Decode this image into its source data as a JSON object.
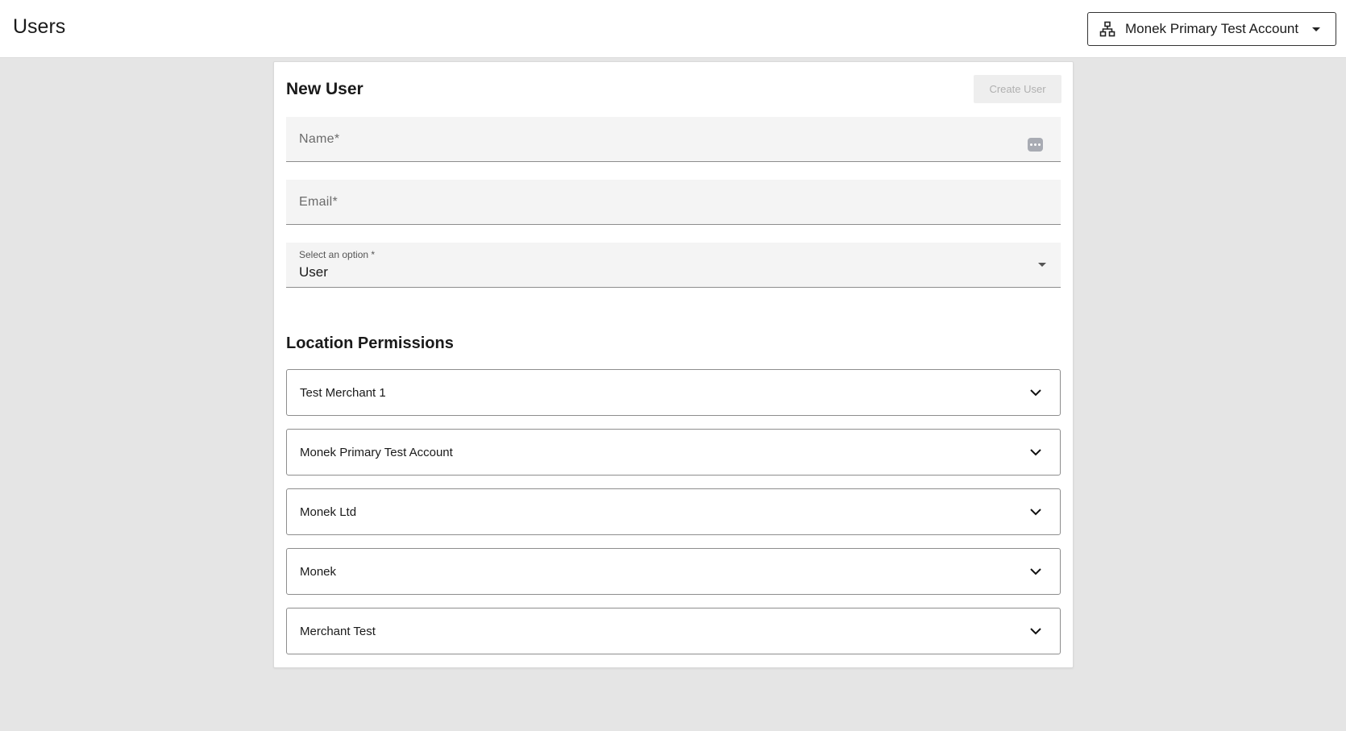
{
  "header": {
    "title": "Users",
    "account_selector": {
      "label": "Monek Primary Test Account",
      "icon": "org-chart-icon"
    }
  },
  "form": {
    "title": "New User",
    "create_button": "Create User",
    "name_field": {
      "placeholder": "Name*"
    },
    "email_field": {
      "placeholder": "Email*"
    },
    "role_select": {
      "label": "Select an option *",
      "value": "User"
    }
  },
  "permissions": {
    "title": "Location Permissions",
    "items": [
      {
        "label": "Test Merchant 1"
      },
      {
        "label": "Monek Primary Test Account"
      },
      {
        "label": "Monek Ltd"
      },
      {
        "label": "Monek"
      },
      {
        "label": "Merchant Test"
      }
    ]
  },
  "colors": {
    "background": "#e5e5e5",
    "card": "#ffffff",
    "field_fill": "#f4f4f4",
    "border": "#8d8d8d",
    "disabled_button": "#eeeeee"
  }
}
